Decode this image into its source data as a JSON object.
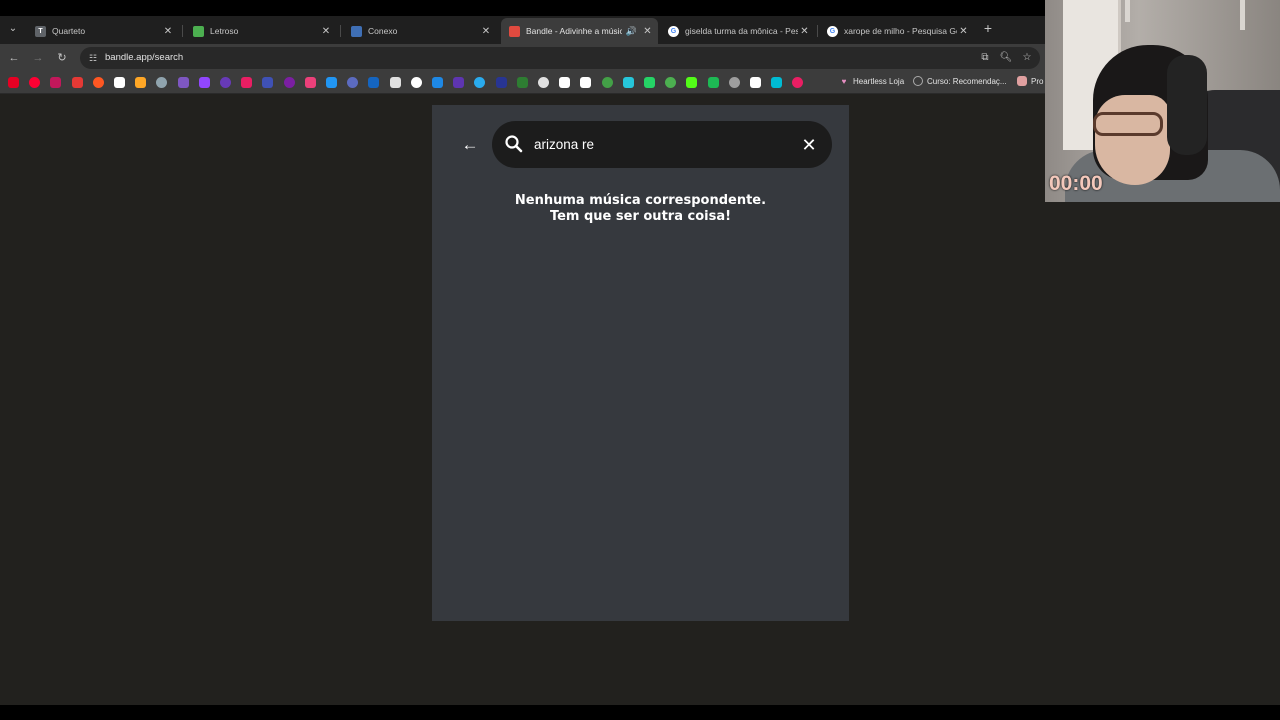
{
  "browser": {
    "tabs": [
      {
        "title": "Quarteto",
        "favicon": "T",
        "favicon_color": "#5f6368",
        "active": false,
        "audio": false
      },
      {
        "title": "Letroso",
        "favicon": "",
        "favicon_color": "#4caf50",
        "active": false,
        "audio": false
      },
      {
        "title": "Conexo",
        "favicon": "",
        "favicon_color": "#3f6fb5",
        "active": false,
        "audio": false
      },
      {
        "title": "Bandle - Adivinhe a música",
        "favicon": "",
        "favicon_color": "#e04a3f",
        "active": true,
        "audio": true
      },
      {
        "title": "giselda turma da mônica - Pesq",
        "favicon": "G",
        "favicon_color": "#ffffff",
        "active": false,
        "audio": false
      },
      {
        "title": "xarope de milho - Pesquisa Goo",
        "favicon": "G",
        "favicon_color": "#ffffff",
        "active": false,
        "audio": false
      }
    ],
    "new_tab_label": "+",
    "url": "bandle.app/search",
    "bookmarks_named": [
      {
        "label": "Heartless Loja",
        "icon": "heart-icon",
        "color": "#e88fc3"
      },
      {
        "label": "Curso: Recomendaç...",
        "icon": "course-icon",
        "color": "#aaaaaa"
      },
      {
        "label": "Pro",
        "icon": "bookmark-icon",
        "color": "#e0a0a0"
      }
    ],
    "bookmark_icon_colors": [
      "#e60023",
      "#ff0033",
      "#c2185b",
      "#e53935",
      "#ff5722",
      "#ffffff",
      "#ffa726",
      "#90a4ae",
      "#7e57c2",
      "#9146ff",
      "#673ab7",
      "#e91e63",
      "#3f51b5",
      "#7b1fa2",
      "#ec407a",
      "#2196f3",
      "#5c6bc0",
      "#1565c0",
      "#e0e0e0",
      "#ffffff",
      "#1e88e5",
      "#5e35b1",
      "#2aabee",
      "#283593",
      "#2e7d32",
      "#e0e0e0",
      "#ffffff",
      "#ffffff",
      "#43a047",
      "#26c6da",
      "#25d366",
      "#4caf50",
      "#53fc18",
      "#1db954",
      "#9e9e9e",
      "#ffffff",
      "#00bcd4",
      "#e91e63"
    ]
  },
  "search": {
    "query": "arizona re",
    "no_match_line1": "Nenhuma música correspondente.",
    "no_match_line2": "Tem que ser outra coisa!"
  },
  "webcam": {
    "timer": "00:00"
  },
  "colors": {
    "page_bg": "#22211e",
    "panel_bg": "#36393e",
    "search_bg": "#1c1c1c",
    "timer": "#f3c8bb"
  }
}
